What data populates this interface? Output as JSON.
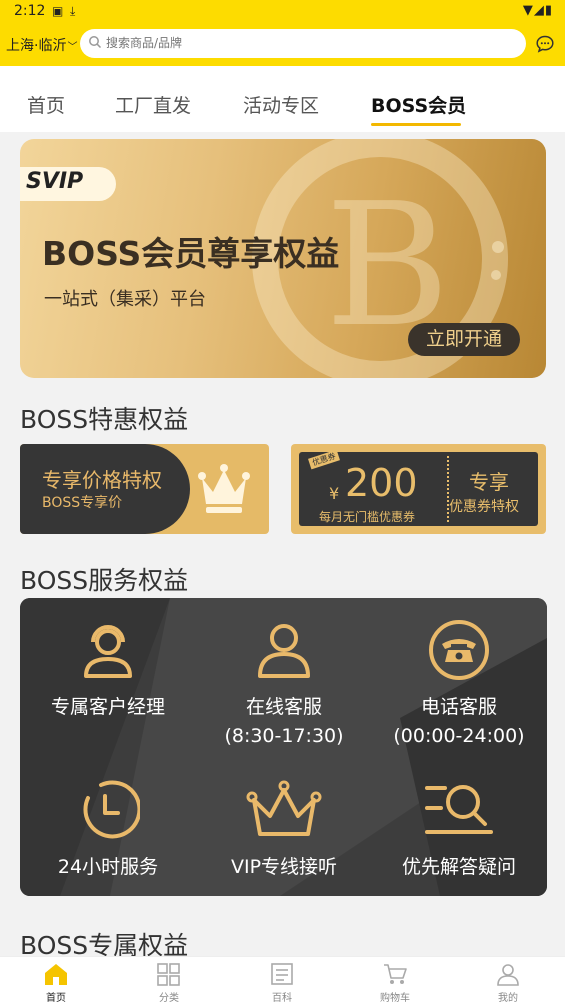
{
  "status_bar": {
    "time": "2:12"
  },
  "header": {
    "location": "上海·临沂",
    "search_placeholder": "搜索商品/品牌"
  },
  "tabs": [
    {
      "label": "首页",
      "active": false
    },
    {
      "label": "工厂直发",
      "active": false
    },
    {
      "label": "活动专区",
      "active": false
    },
    {
      "label": "BOSS会员",
      "active": true
    }
  ],
  "banner": {
    "badge": "SVIP",
    "title": "BOSS会员尊享权益",
    "subtitle": "一站式（集采）平台",
    "cta": "立即开通"
  },
  "sections": {
    "special": "BOSS特惠权益",
    "service": "BOSS服务权益",
    "exclusive": "BOSS专属权益"
  },
  "special_cards": {
    "price": {
      "title": "专享价格特权",
      "subtitle": "BOSS专享价"
    },
    "coupon": {
      "tag": "优惠券",
      "currency": "¥",
      "amount": "200",
      "desc": "每月无门槛优惠券",
      "right_title": "专享",
      "right_sub": "优惠券特权"
    }
  },
  "services": [
    {
      "icon": "headset-agent-icon",
      "label": "专属客户经理",
      "sub": ""
    },
    {
      "icon": "person-icon",
      "label": "在线客服",
      "sub": "(8:30-17:30)"
    },
    {
      "icon": "telephone-icon",
      "label": "电话客服",
      "sub": "(00:00-24:00)"
    },
    {
      "icon": "clock-icon",
      "label": "24小时服务",
      "sub": ""
    },
    {
      "icon": "crown-icon",
      "label": "VIP专线接听",
      "sub": ""
    },
    {
      "icon": "search-list-icon",
      "label": "优先解答疑问",
      "sub": ""
    }
  ],
  "bottom_nav": [
    {
      "icon": "home-icon",
      "label": "首页",
      "active": true
    },
    {
      "icon": "category-icon",
      "label": "分类",
      "active": false
    },
    {
      "icon": "encyclopedia-icon",
      "label": "百科",
      "active": false
    },
    {
      "icon": "cart-icon",
      "label": "购物车",
      "active": false
    },
    {
      "icon": "profile-icon",
      "label": "我的",
      "active": false
    }
  ],
  "colors": {
    "brand_yellow": "#fddc00",
    "gold": "#e8bd6b",
    "dark": "#363636"
  }
}
